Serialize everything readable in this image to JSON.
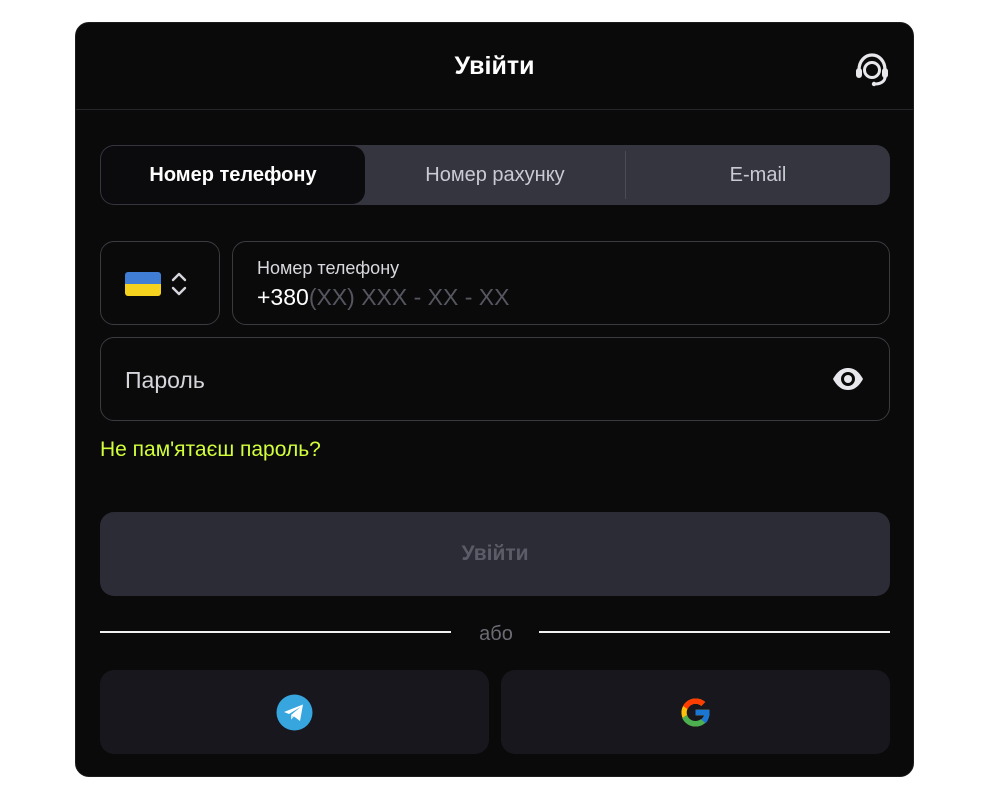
{
  "header": {
    "title": "Увійти",
    "support_icon": "headset-icon"
  },
  "tabs": [
    {
      "label": "Номер телефону",
      "active": true
    },
    {
      "label": "Номер рахунку",
      "active": false
    },
    {
      "label": "E-mail",
      "active": false
    }
  ],
  "phone": {
    "country_flag": "ukraine-flag-icon",
    "label": "Номер телефону",
    "prefix": "+380",
    "placeholder": "(XX) XXX - XX - XX"
  },
  "password": {
    "placeholder": "Пароль",
    "toggle_icon": "eye-icon"
  },
  "forgot_link": "Не пам'ятаєш пароль?",
  "submit_label": "Увійти",
  "divider_text": "або",
  "social": [
    {
      "name": "telegram",
      "icon": "telegram-icon"
    },
    {
      "name": "google",
      "icon": "google-icon"
    }
  ],
  "colors": {
    "modal_bg": "#0a0a0b",
    "tabs_bg": "#34353f",
    "accent_link": "#d2ff3a",
    "button_disabled_bg": "#2c2c36",
    "telegram_blue": "#37a6df"
  }
}
